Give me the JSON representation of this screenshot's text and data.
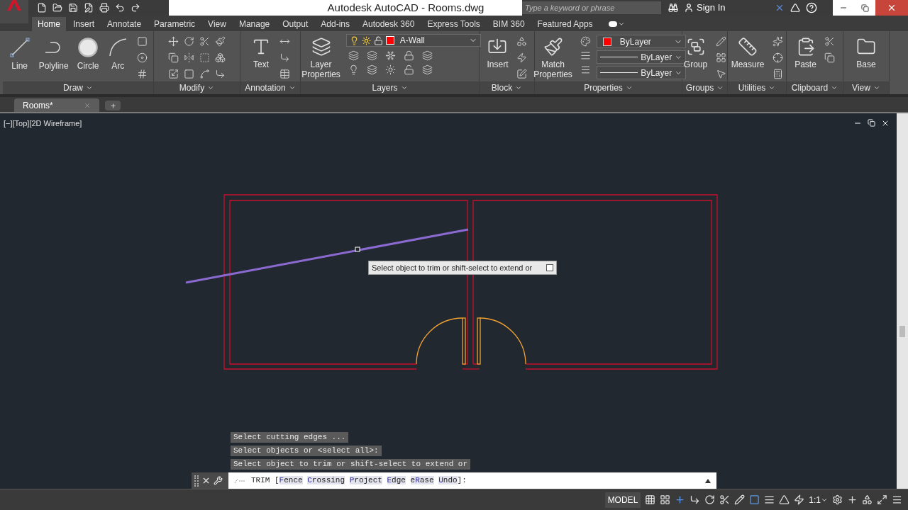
{
  "window": {
    "title": "Autodesk AutoCAD - Rooms.dwg"
  },
  "search": {
    "placeholder": "Type a keyword or phrase"
  },
  "account": {
    "label": "Sign In"
  },
  "ribbon_tabs": [
    {
      "label": "Home",
      "selected": true
    },
    {
      "label": "Insert",
      "selected": false
    },
    {
      "label": "Annotate",
      "selected": false
    },
    {
      "label": "Parametric",
      "selected": false
    },
    {
      "label": "View",
      "selected": false
    },
    {
      "label": "Manage",
      "selected": false
    },
    {
      "label": "Output",
      "selected": false
    },
    {
      "label": "Add-ins",
      "selected": false
    },
    {
      "label": "Autodesk 360",
      "selected": false
    },
    {
      "label": "Express Tools",
      "selected": false
    },
    {
      "label": "BIM 360",
      "selected": false
    },
    {
      "label": "Featured Apps",
      "selected": false
    }
  ],
  "panels": [
    {
      "title": "Draw",
      "tools": [
        "Line",
        "Polyline",
        "Circle",
        "Arc"
      ]
    },
    {
      "title": "Modify"
    },
    {
      "title": "Annotation",
      "tools": [
        "Text"
      ]
    },
    {
      "title": "Layers",
      "tools": [
        "Layer Properties"
      ],
      "layer": {
        "name": "A-Wall",
        "color": "#ff0000"
      }
    },
    {
      "title": "Block",
      "tools": [
        "Insert"
      ]
    },
    {
      "title": "Properties",
      "tools": [
        "Match Properties"
      ],
      "dropdowns": [
        {
          "kind": "color",
          "label": "ByLayer",
          "color": "#ff0000"
        },
        {
          "kind": "line",
          "label": "ByLayer"
        },
        {
          "kind": "line",
          "label": "ByLayer"
        }
      ]
    },
    {
      "title": "Groups",
      "tools": [
        "Group"
      ]
    },
    {
      "title": "Utilities",
      "tools": [
        "Measure"
      ]
    },
    {
      "title": "Clipboard",
      "tools": [
        "Paste"
      ]
    },
    {
      "title": "View",
      "tools": [
        "Base"
      ]
    }
  ],
  "file_tabs": [
    {
      "label": "Rooms*",
      "selected": true
    }
  ],
  "viewport": {
    "label": "[−][Top][2D Wireframe]"
  },
  "tooltip": {
    "text": "Select object to trim or shift-select to extend or"
  },
  "command_history": [
    "Select cutting edges ...",
    "Select objects or <select all>:",
    "Select object to trim or shift-select to extend or"
  ],
  "command_line": {
    "command": "TRIM [",
    "options": [
      {
        "key": "F",
        "after": "ence"
      },
      {
        "key": "C",
        "after": "rossing"
      },
      {
        "key": "P",
        "after": "roject"
      },
      {
        "key": "E",
        "after": "dge"
      },
      {
        "before": "e",
        "key": "R",
        "after": "ase"
      },
      {
        "key": "U",
        "after": "ndo"
      }
    ],
    "end": "]:"
  },
  "status_bar": {
    "model": "MODEL",
    "scale": "1:1"
  }
}
